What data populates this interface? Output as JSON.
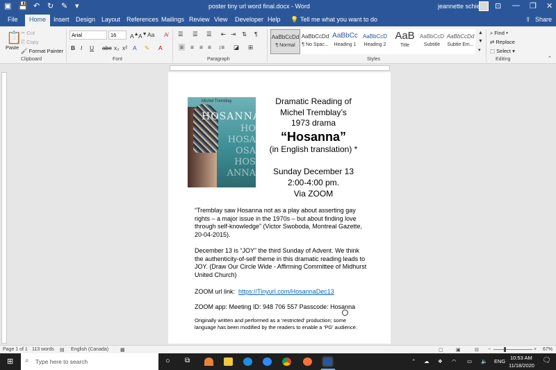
{
  "titlebar": {
    "title": "poster tiny url word final.docx - Word",
    "user": "jeannette schieck"
  },
  "tabs": [
    "File",
    "Home",
    "Insert",
    "Design",
    "Layout",
    "References",
    "Mailings",
    "Review",
    "View",
    "Developer",
    "Help"
  ],
  "tell_me": "Tell me what you want to do",
  "share": "Share",
  "ribbon": {
    "clipboard": {
      "paste": "Paste",
      "cut": "Cut",
      "copy": "Copy",
      "format_painter": "Format Painter",
      "label": "Clipboard"
    },
    "font": {
      "name": "Arial",
      "size": "16",
      "label": "Font",
      "grow": "A^",
      "shrink": "A^",
      "case": "Aa"
    },
    "paragraph": {
      "label": "Paragraph"
    },
    "styles": {
      "label": "Styles",
      "items": [
        {
          "preview": "AaBbCcDd",
          "name": "¶ Normal"
        },
        {
          "preview": "AaBbCcDd",
          "name": "¶ No Spac..."
        },
        {
          "preview": "AaBbCc",
          "name": "Heading 1"
        },
        {
          "preview": "AaBbCcD",
          "name": "Heading 2"
        },
        {
          "preview": "AaB",
          "name": "Title"
        },
        {
          "preview": "AaBbCcD",
          "name": "Subtitle"
        },
        {
          "preview": "AaBbCcDd",
          "name": "Subtle Em..."
        }
      ]
    },
    "editing": {
      "find": "Find",
      "replace": "Replace",
      "select": "Select",
      "label": "Editing"
    }
  },
  "document": {
    "poster": {
      "header": "Michel Tremblay",
      "title": "HOSANNA"
    },
    "heading": {
      "line1": "Dramatic Reading of",
      "line2": "Michel Tremblay’s",
      "line3": "1973 drama",
      "title": "“Hosanna”",
      "line4": "(in English translation) *",
      "date": "Sunday December 13",
      "time": "2:00-4:00 pm.",
      "via": "Via ZOOM"
    },
    "quote": "“Tremblay saw Hosanna not as a play about asserting gay rights – a major issue in the 1970s – but about finding love through self-knowledge” (Victor Swoboda, Montreal Gazette, 20-04-2015).",
    "advent": "December 13 is “JOY” the third Sunday of Advent. We think the authenticity-of-self theme in this dramatic reading leads to JOY. (Draw Our Circle Wide - Affirming Committee of Midhurst United Church)",
    "zoom_url_label": "ZOOM url link:",
    "zoom_url": "https://Tinyurl.com/HosannaDec13",
    "zoom_app": "ZOOM app:  Meeting ID: 948 706 557 Passcode: Hosanna",
    "footnote": "Originally written and performed as a ‘restricted’ production; some language has been modified by the readers to enable a ‘PG’ audience."
  },
  "status": {
    "page": "Page 1 of 1",
    "words": "113 words",
    "language": "English (Canada)",
    "zoom": "67%"
  },
  "taskbar": {
    "search_placeholder": "Type here to search",
    "time": "10:53 AM",
    "date": "11/18/2020",
    "lang": "ENG"
  },
  "colors": {
    "word_blue": "#2b579a",
    "link": "#0563c1"
  }
}
